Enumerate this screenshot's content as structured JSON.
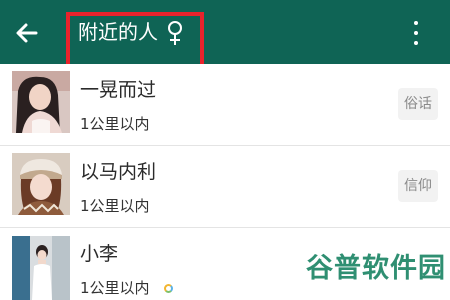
{
  "header": {
    "title": "附近的人",
    "gender_icon": "female-symbol-icon",
    "back_icon": "arrow-left-icon",
    "more_icon": "more-vertical-icon",
    "background_color": "#0f6455"
  },
  "annotation": {
    "highlight_color": "#e8232c"
  },
  "people": [
    {
      "name": "一晃而过",
      "distance": "1公里以内",
      "badge": "俗话"
    },
    {
      "name": "以马内利",
      "distance": "1公里以内",
      "badge": "信仰"
    },
    {
      "name": "小李",
      "distance": "1公里以内",
      "badge": "",
      "status_icon": "colorful-ring-icon"
    }
  ],
  "watermark": {
    "text": "谷普软件园"
  }
}
